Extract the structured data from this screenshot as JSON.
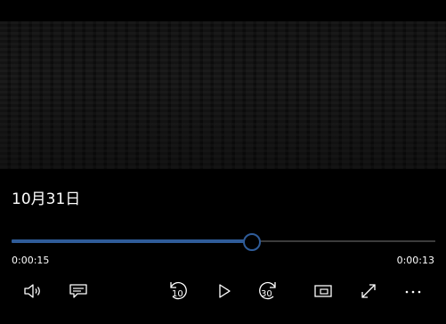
{
  "video": {
    "title": "10月31日"
  },
  "playback": {
    "elapsed": "0:00:15",
    "remaining": "0:00:13",
    "progress_fraction": 0.566
  },
  "colors": {
    "accent": "#2f5c99",
    "background": "#000000",
    "track": "#3b3b3b",
    "text": "#ffffff"
  },
  "controls": {
    "skip_back_seconds": "10",
    "skip_forward_seconds": "30",
    "icons": [
      "volume-icon",
      "subtitles-icon",
      "skip-back-10-icon",
      "play-icon",
      "skip-forward-30-icon",
      "mini-view-icon",
      "fullscreen-icon",
      "more-options-icon"
    ]
  }
}
